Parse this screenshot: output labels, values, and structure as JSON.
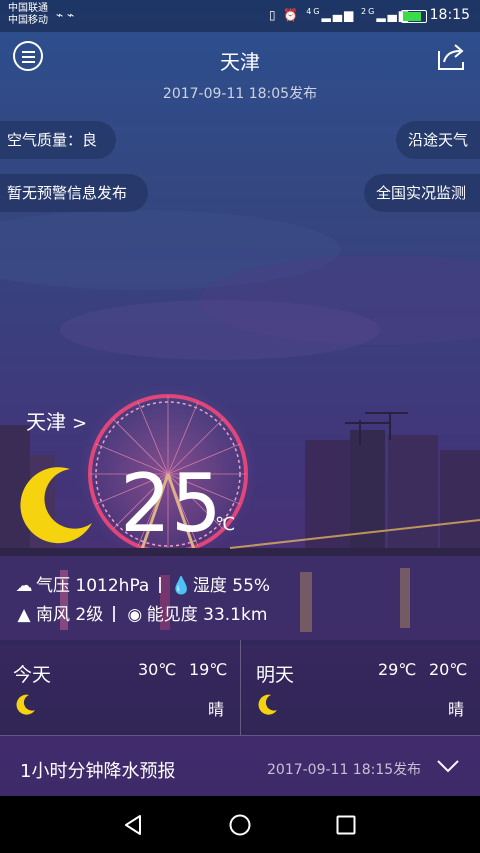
{
  "status_bar": {
    "carrier_1": "中国联通",
    "carrier_2": "中国移动",
    "signal_1": "4G",
    "signal_2": "2G",
    "time": "18:15"
  },
  "header": {
    "city": "天津",
    "published": "2017-09-11 18:05发布"
  },
  "pills": {
    "air_quality": "空气质量：良",
    "route_weather": "沿途天气",
    "warning": "暂无预警信息发布",
    "national_monitor": "全国实况监测"
  },
  "current": {
    "location": "天津",
    "temperature": "25",
    "unit": "℃",
    "pressure": "气压 1012hPa",
    "humidity": "湿度 55%",
    "wind": "南风 2级",
    "visibility": "能见度 33.1km"
  },
  "forecast": [
    {
      "day": "今天",
      "high": "30℃",
      "low": "19℃",
      "condition": "晴",
      "icon": "moon-icon"
    },
    {
      "day": "明天",
      "high": "29℃",
      "low": "20℃",
      "condition": "晴",
      "icon": "moon-icon"
    }
  ],
  "precip": {
    "title": "1小时分钟降水预报",
    "published": "2017-09-11 18:15发布"
  },
  "colors": {
    "moon": "#f5d40f",
    "battery": "#3bdc4a",
    "wheel": "#e0467a"
  }
}
